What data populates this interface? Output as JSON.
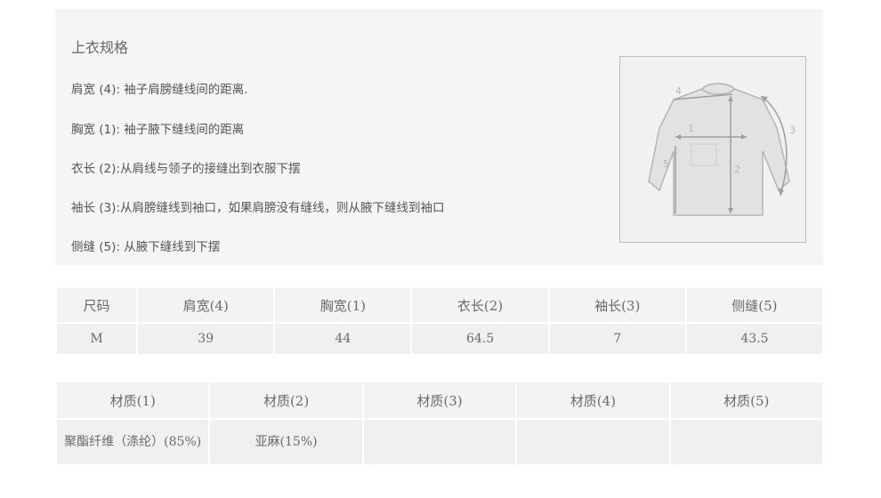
{
  "spec": {
    "title": "上衣规格",
    "lines": [
      "肩宽 (4): 袖子肩膀缝线间的距离.",
      "胸宽 (1): 袖子腋下缝线间的距离",
      "衣长 (2):从肩线与领子的接缝出到衣服下摆",
      "袖长 (3):从肩膀缝线到袖口，如果肩膀没有缝线，则从腋下缝线到袖口",
      "侧缝 (5): 从腋下缝线到下摆"
    ],
    "diagram_labels": [
      "1",
      "2",
      "3",
      "4",
      "5"
    ]
  },
  "size_table": {
    "headers": [
      "尺码",
      "肩宽(4)",
      "胸宽(1)",
      "衣长(2)",
      "袖长(3)",
      "侧缝(5)"
    ],
    "row": [
      "M",
      "39",
      "44",
      "64.5",
      "7",
      "43.5"
    ]
  },
  "material_table": {
    "headers": [
      "材质(1)",
      "材质(2)",
      "材质(3)",
      "材质(4)",
      "材质(5)"
    ],
    "row": [
      "聚酯纤维（涤纶）(85%)",
      "亚麻(15%)",
      "",
      "",
      ""
    ]
  }
}
